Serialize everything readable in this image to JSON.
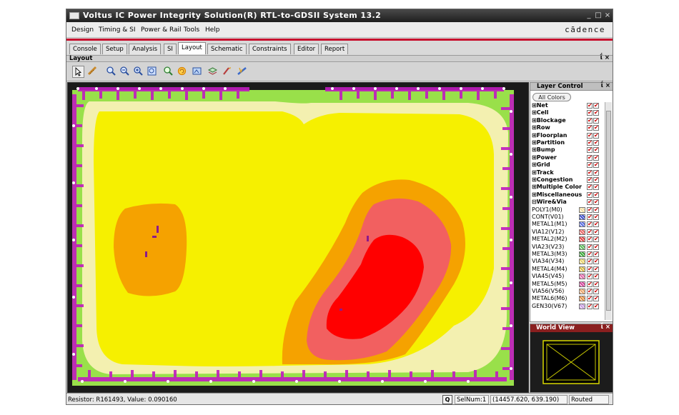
{
  "window": {
    "title": "Voltus IC Power Integrity Solution(R) RTL-to-GDSII System 13.2",
    "controls": [
      "_",
      "□",
      "×"
    ]
  },
  "menubar": {
    "items": [
      {
        "label": "Design",
        "underline": "D"
      },
      {
        "label": "Timing & SI",
        "underline": "T"
      },
      {
        "label": "Power & Rail",
        "underline": "P"
      },
      {
        "label": "Tools",
        "underline": "o"
      },
      {
        "label": "Help",
        "underline": "H"
      }
    ],
    "brand": "cādence"
  },
  "tabs": [
    {
      "label": "Console",
      "active": false
    },
    {
      "label": "Setup",
      "active": false
    },
    {
      "label": "Analysis",
      "active": false
    },
    {
      "label": "SI",
      "active": false
    },
    {
      "label": "Layout",
      "active": true
    },
    {
      "label": "Schematic",
      "active": false
    },
    {
      "label": "Constraints",
      "active": false
    },
    {
      "label": "Editor",
      "active": false
    },
    {
      "label": "Report",
      "active": false
    }
  ],
  "layout_panel": {
    "title": "Layout",
    "controls": "ΐ ×"
  },
  "toolbar": {
    "icons": [
      "select-arrow-icon",
      "ruler-icon",
      "zoom-in-icon",
      "zoom-out-icon",
      "zoom-fit-icon",
      "zoom-area-icon",
      "zoom-previous-icon",
      "refresh-icon",
      "snapshot-icon",
      "layer-icon",
      "brush-icon",
      "ruler-measure-icon"
    ]
  },
  "layer_control": {
    "title": "Layer Control",
    "controls": "ΐ ×",
    "all_colors": "All Colors",
    "groups": [
      {
        "label": "Net",
        "expanded": false
      },
      {
        "label": "Cell",
        "expanded": false
      },
      {
        "label": "Blockage",
        "expanded": false
      },
      {
        "label": "Row",
        "expanded": false
      },
      {
        "label": "Floorplan",
        "expanded": false
      },
      {
        "label": "Partition",
        "expanded": false
      },
      {
        "label": "Bump",
        "expanded": false
      },
      {
        "label": "Power",
        "expanded": false
      },
      {
        "label": "Grid",
        "expanded": false
      },
      {
        "label": "Track",
        "expanded": false
      },
      {
        "label": "Congestion",
        "expanded": false
      },
      {
        "label": "Multiple Color",
        "expanded": false
      },
      {
        "label": "Miscellaneous",
        "expanded": false
      },
      {
        "label": "Wire&Via",
        "expanded": true
      }
    ],
    "layers": [
      {
        "label": "POLY1(M0)",
        "color": "#f2dca0"
      },
      {
        "label": "CONT(V01)",
        "color": "#3f4fc9"
      },
      {
        "label": "METAL1(M1)",
        "color": "#5b6fe0"
      },
      {
        "label": "VIA12(V12)",
        "color": "#e86a6a"
      },
      {
        "label": "METAL2(M2)",
        "color": "#e14444"
      },
      {
        "label": "VIA23(V23)",
        "color": "#5cba5c"
      },
      {
        "label": "METAL3(M3)",
        "color": "#3aa83a"
      },
      {
        "label": "VIA34(V34)",
        "color": "#e8d26a"
      },
      {
        "label": "METAL4(M4)",
        "color": "#d9b640"
      },
      {
        "label": "VIA45(V45)",
        "color": "#e06aa8"
      },
      {
        "label": "METAL5(M5)",
        "color": "#d2449a"
      },
      {
        "label": "VIA56(V56)",
        "color": "#e8a46a"
      },
      {
        "label": "METAL6(M6)",
        "color": "#e08a3e"
      },
      {
        "label": "GEN30(V67)",
        "color": "#c79de0"
      }
    ]
  },
  "world_view": {
    "title": "World View",
    "controls": "ΐ ×"
  },
  "status": {
    "message": "Resistor: R161493, Value: 0.090160",
    "query_button": "Q",
    "selnum": "SelNum:1",
    "coords": "(14457.620, 639.190)",
    "state": "Routed"
  },
  "colors": {
    "ir_low": "#99e04a",
    "ir_lowmid": "#f3f0b0",
    "ir_mid": "#f6f000",
    "ir_midhigh": "#f5a200",
    "ir_high": "#f26060",
    "ir_peak": "#ff0000",
    "io_magenta": "#c01bc0"
  }
}
